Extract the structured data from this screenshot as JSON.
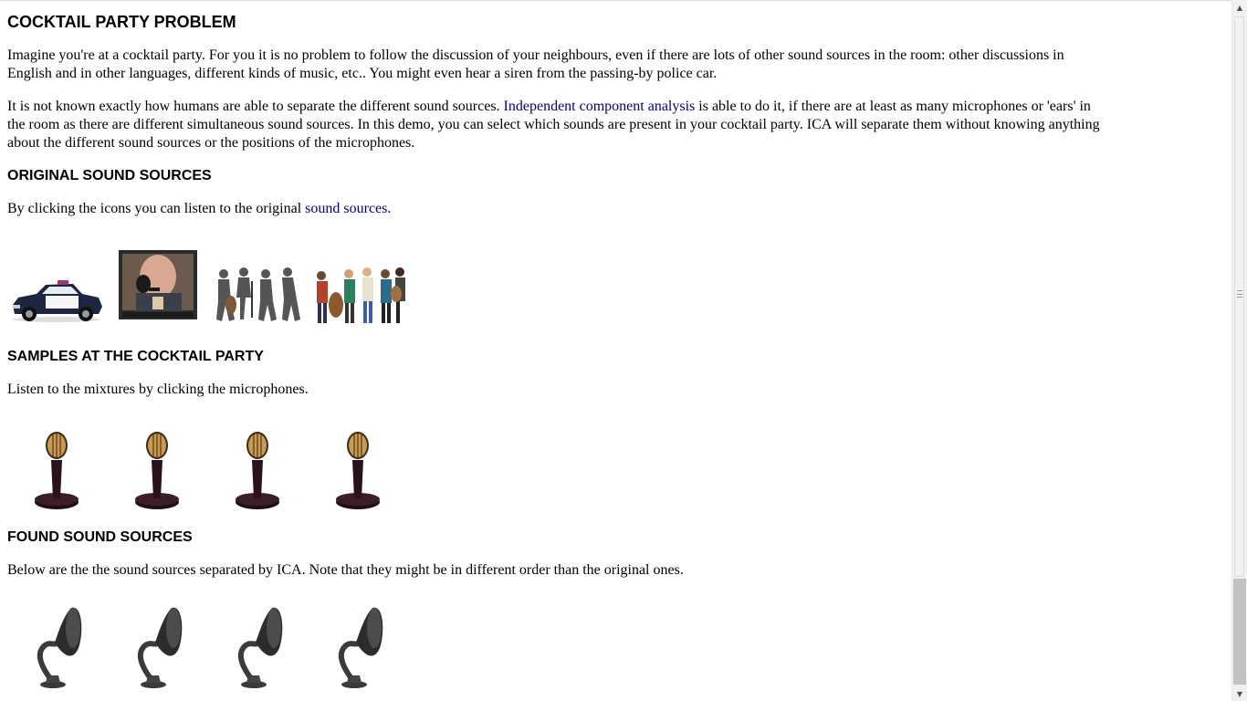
{
  "page": {
    "title": "COCKTAIL PARTY PROBLEM",
    "intro_1": "Imagine you're at a cocktail party. For you it is no problem to follow the discussion of your neighbours, even if there are lots of other sound sources in the room: other discussions in English and in other languages, different kinds of music, etc.. You might even hear a siren from the passing-by police car.",
    "intro_2_pre": "It is not known exactly how humans are able to separate the different sound sources. ",
    "intro_2_link": "Independent component analysis",
    "intro_2_post": " is able to do it, if there are at least as many microphones or 'ears' in the room as there are different simultaneous sound sources. In this demo, you can select which sounds are present in your cocktail party. ICA will separate them without knowing anything about the different sound sources or the positions of the microphones."
  },
  "original": {
    "heading": "ORIGINAL SOUND SOURCES",
    "text_pre": "By clicking the icons you can listen to the original ",
    "text_link": "sound sources",
    "text_post": ".",
    "icons": [
      "police-car-icon",
      "tv-speaker-icon",
      "classical-quartet-icon",
      "folk-band-icon"
    ]
  },
  "samples": {
    "heading": "SAMPLES AT THE COCKTAIL PARTY",
    "text": "Listen to the mixtures by clicking the microphones.",
    "count": 4
  },
  "found": {
    "heading": "FOUND SOUND SOURCES",
    "text": "Below are the the sound sources separated by ICA. Note that they might be in different order than the original ones.",
    "count": 4
  },
  "colors": {
    "link": "#00008b",
    "text": "#000000",
    "background": "#ffffff"
  }
}
